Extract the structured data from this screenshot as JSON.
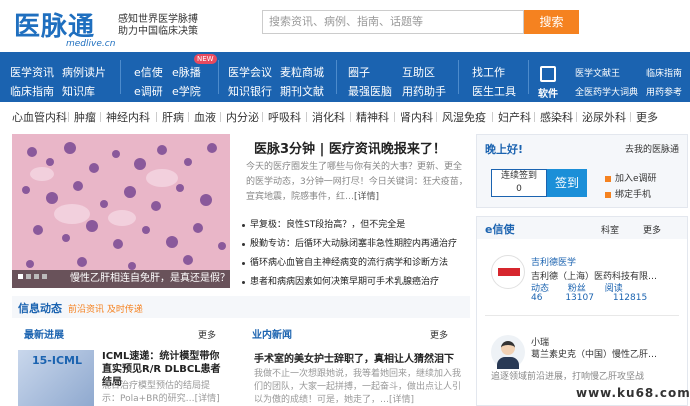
{
  "header": {
    "logo_text": "医脉通",
    "logo_sub": "medlive.cn",
    "slogan_line1": "感知世界医学脉搏",
    "slogan_line2": "助力中国临床决策",
    "search_placeholder": "搜索资讯、病例、指南、话题等",
    "search_button": "搜索"
  },
  "nav": {
    "col1": [
      "医学资讯",
      "临床指南"
    ],
    "col2": [
      "病例读片",
      "知识库"
    ],
    "col3": [
      "e信使",
      "e调研"
    ],
    "col4": [
      "e脉播",
      "e学院"
    ],
    "new_badge": "NEW",
    "col5": [
      "医学会议",
      "知识银行"
    ],
    "col6": [
      "麦粒商城",
      "期刊文献"
    ],
    "col7": [
      "圈子",
      "最强医脑"
    ],
    "col8": [
      "互助区",
      "用药助手"
    ],
    "col9": [
      "找工作",
      "医生工具"
    ],
    "software": "软件",
    "col10": [
      "医学文献王",
      "全医药学大词典"
    ],
    "col11": [
      "临床指南",
      "用药参考"
    ]
  },
  "categories": [
    "心血管内科",
    "肿瘤",
    "神经内科",
    "肝病",
    "血液",
    "内分泌",
    "呼吸科",
    "消化科",
    "精神科",
    "肾内科",
    "风湿免疫",
    "妇产科",
    "感染科",
    "泌尿外科",
    "更多"
  ],
  "hero": {
    "caption": "慢性乙肝相连自免肝，是真还是假？"
  },
  "main_article": {
    "title": "医脉3分钟 | 医疗资讯晚报来了！",
    "desc": "今天的医疗圈发生了哪些与你有关的大事？更新、更全的医学动态，3分钟一网打尽！今日关键词：狂犬疫苗，宣宾地震，院感事件，红…",
    "desc_link": "[详情]",
    "list": [
      "早复极：良性ST段抬高？，但不完全是",
      "殷勤专访：后循环大动脉闭塞非急性期腔内再通治疗",
      "循环病心血管自主神经病变的流行病学和诊断方法",
      "患者和病病因素如何决策早期可手术乳腺癌治疗"
    ]
  },
  "right_top": {
    "greeting": "晚上好!",
    "home_link": "去我的医脉通",
    "sign_label": "连续签到",
    "sign_count": "0",
    "sign_button": "签到",
    "action1": "加入e调研",
    "action2": "绑定手机"
  },
  "xinshi": {
    "title": "e信使",
    "category": "科室",
    "more": "更多",
    "items": [
      {
        "name": "吉利德医学",
        "desc": "吉利德（上海）医药科技有限…",
        "stat_labels": [
          "动态",
          "粉丝",
          "阅读"
        ],
        "stat_values": [
          "46",
          "13107",
          "112815"
        ]
      },
      {
        "name": "小瑞",
        "desc": "葛兰素史克（中国）慢性乙肝…",
        "extra": "追逐领域前沿进展，打响慢乙肝攻坚战"
      }
    ]
  },
  "info": {
    "title": "信息动态",
    "tagline": "前沿资讯 及时传递",
    "col_left_title": "最新进展",
    "col_right_title": "业内新闻",
    "more": "更多",
    "thumb_text": "15-ICML",
    "left_news_title": "ICML速递：统计模型带你直实预见R/R DLBCL患者结局",
    "left_news_text": "混合治疗模型预估的结局提示：Pola+BR的研究…[详情]",
    "right_news_title": "手术室的美女护士辞职了，真相让人猜然泪下",
    "right_news_text": "我做不止一次想跟她说，我等着她回来，继续加入我们的团队，大家一起拼搏，一起奋斗，做出点让人引以为傲的成绩！可是，她走了，…[详情]"
  },
  "watermark": "www.ku68.com"
}
